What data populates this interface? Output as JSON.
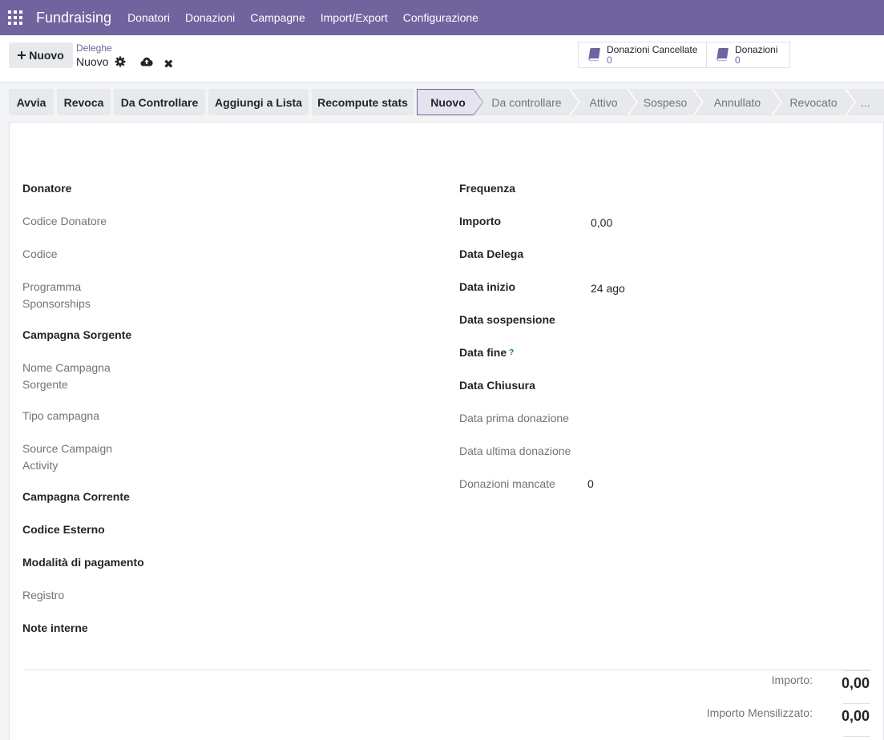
{
  "navbar": {
    "app_name": "Fundraising",
    "menu": [
      "Donatori",
      "Donazioni",
      "Campagne",
      "Import/Export",
      "Configurazione"
    ]
  },
  "control": {
    "new_label": "Nuovo",
    "breadcrumb": "Deleghe",
    "record_name": "Nuovo",
    "stats": [
      {
        "label": "Donazioni Cancellate",
        "value": "0"
      },
      {
        "label": "Donazioni",
        "value": "0"
      }
    ]
  },
  "actions": [
    "Avvia",
    "Revoca",
    "Da Controllare",
    "Aggiungi a Lista",
    "Recompute stats"
  ],
  "stages": [
    "Nuovo",
    "Da controllare",
    "Attivo",
    "Sospeso",
    "Annullato",
    "Revocato",
    "..."
  ],
  "form": {
    "left": [
      {
        "label": "Donatore",
        "value": ""
      },
      {
        "label": "Codice Donatore",
        "value": ""
      },
      {
        "label": "Codice",
        "value": ""
      },
      {
        "label": "Programma Sponsorships",
        "value": ""
      },
      {
        "label": "Campagna Sorgente",
        "value": ""
      },
      {
        "label": "Nome Campagna Sorgente",
        "value": ""
      },
      {
        "label": "Tipo campagna",
        "value": ""
      },
      {
        "label": "Source Campaign Activity",
        "value": ""
      },
      {
        "label": "Campagna Corrente",
        "value": ""
      },
      {
        "label": "Codice Esterno",
        "value": ""
      },
      {
        "label": "Modalità di pagamento",
        "value": ""
      },
      {
        "label": "Registro",
        "value": ""
      },
      {
        "label": "Note interne",
        "value": ""
      }
    ],
    "right": [
      {
        "label": "Frequenza",
        "value": ""
      },
      {
        "label": "Importo",
        "value": "0,00"
      },
      {
        "label": "Data Delega",
        "value": ""
      },
      {
        "label": "Data inizio",
        "value": "24 ago"
      },
      {
        "label": "Data sospensione",
        "value": ""
      },
      {
        "label": "Data fine",
        "value": "",
        "help": "?"
      },
      {
        "label": "Data Chiusura",
        "value": ""
      },
      {
        "label": "Data prima donazione",
        "value": ""
      },
      {
        "label": "Data ultima donazione",
        "value": ""
      },
      {
        "label": "Donazioni mancate",
        "value": "0"
      }
    ]
  },
  "totals": [
    {
      "label": "Importo:",
      "value": "0,00"
    },
    {
      "label": "Importo Mensilizzato:",
      "value": "0,00"
    }
  ],
  "colors": {
    "brand": "#71639e",
    "button_bg": "#e7e9ed",
    "stage_active_bg": "#e6e2f0"
  }
}
